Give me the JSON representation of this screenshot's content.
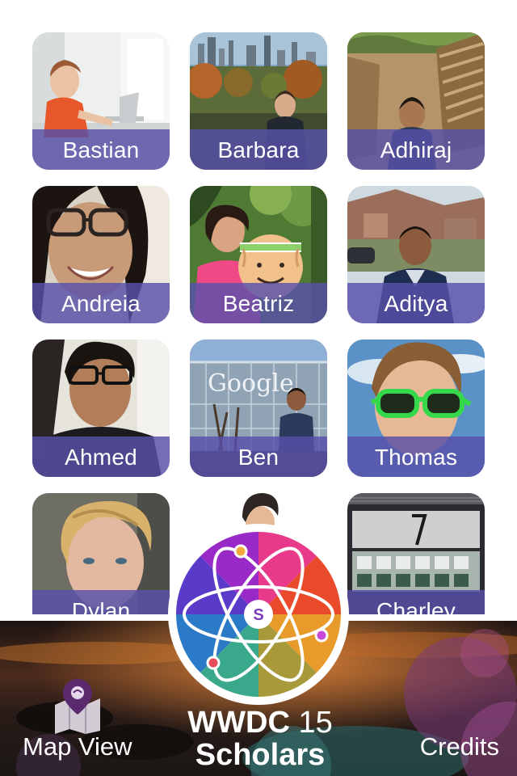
{
  "scholars": [
    {
      "name": "Bastian"
    },
    {
      "name": "Barbara"
    },
    {
      "name": "Adhiraj"
    },
    {
      "name": "Andreia"
    },
    {
      "name": "Beatriz"
    },
    {
      "name": "Aditya"
    },
    {
      "name": "Ahmed"
    },
    {
      "name": "Ben"
    },
    {
      "name": "Thomas"
    },
    {
      "name": "Dylan"
    },
    {
      "name": "Charley"
    }
  ],
  "photo_text": {
    "google_sign": "Google"
  },
  "toolbar": {
    "map_view_label": "Map View",
    "credits_label": "Credits",
    "map_icon": "map-pin-icon"
  },
  "brand": {
    "wwdc": "WWDC",
    "year": "15",
    "scholars": "Scholars",
    "logo_letter": "S"
  },
  "colors": {
    "name_bar": "#5850AA",
    "logo_ring": "#FFFFFF",
    "pin": "#5B2A6E"
  }
}
